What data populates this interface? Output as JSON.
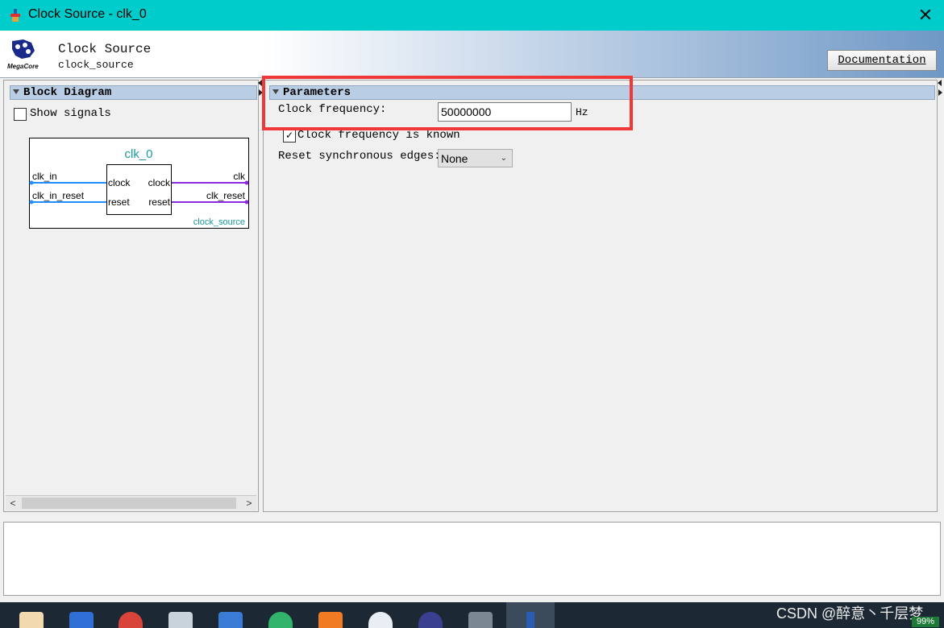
{
  "window": {
    "title": "Clock Source - clk_0"
  },
  "header": {
    "title": "Clock Source",
    "subtitle": "clock_source",
    "documentation_label": "Documentation",
    "logo_text": "MegaCore"
  },
  "block_diagram": {
    "section_title": "Block Diagram",
    "show_signals_label": "Show signals",
    "instance_name": "clk_0",
    "component_type": "clock_source",
    "inputs": [
      "clk_in",
      "clk_in_reset"
    ],
    "outputs": [
      "clk",
      "clk_reset"
    ],
    "ports_in": [
      "clock",
      "reset"
    ],
    "ports_out": [
      "clock",
      "reset"
    ],
    "input_color": "#1f8fff",
    "output_color": "#8a2be2"
  },
  "parameters": {
    "section_title": "Parameters",
    "clock_frequency_label": "Clock frequency:",
    "clock_frequency_value": "50000000",
    "clock_frequency_unit": "Hz",
    "frequency_known_label": "Clock frequency is known",
    "frequency_known_checked": true,
    "reset_edges_label": "Reset synchronous edges:",
    "reset_edges_value": "None"
  },
  "watermark": "CSDN @醉意丶千层梦",
  "battery": "99%"
}
